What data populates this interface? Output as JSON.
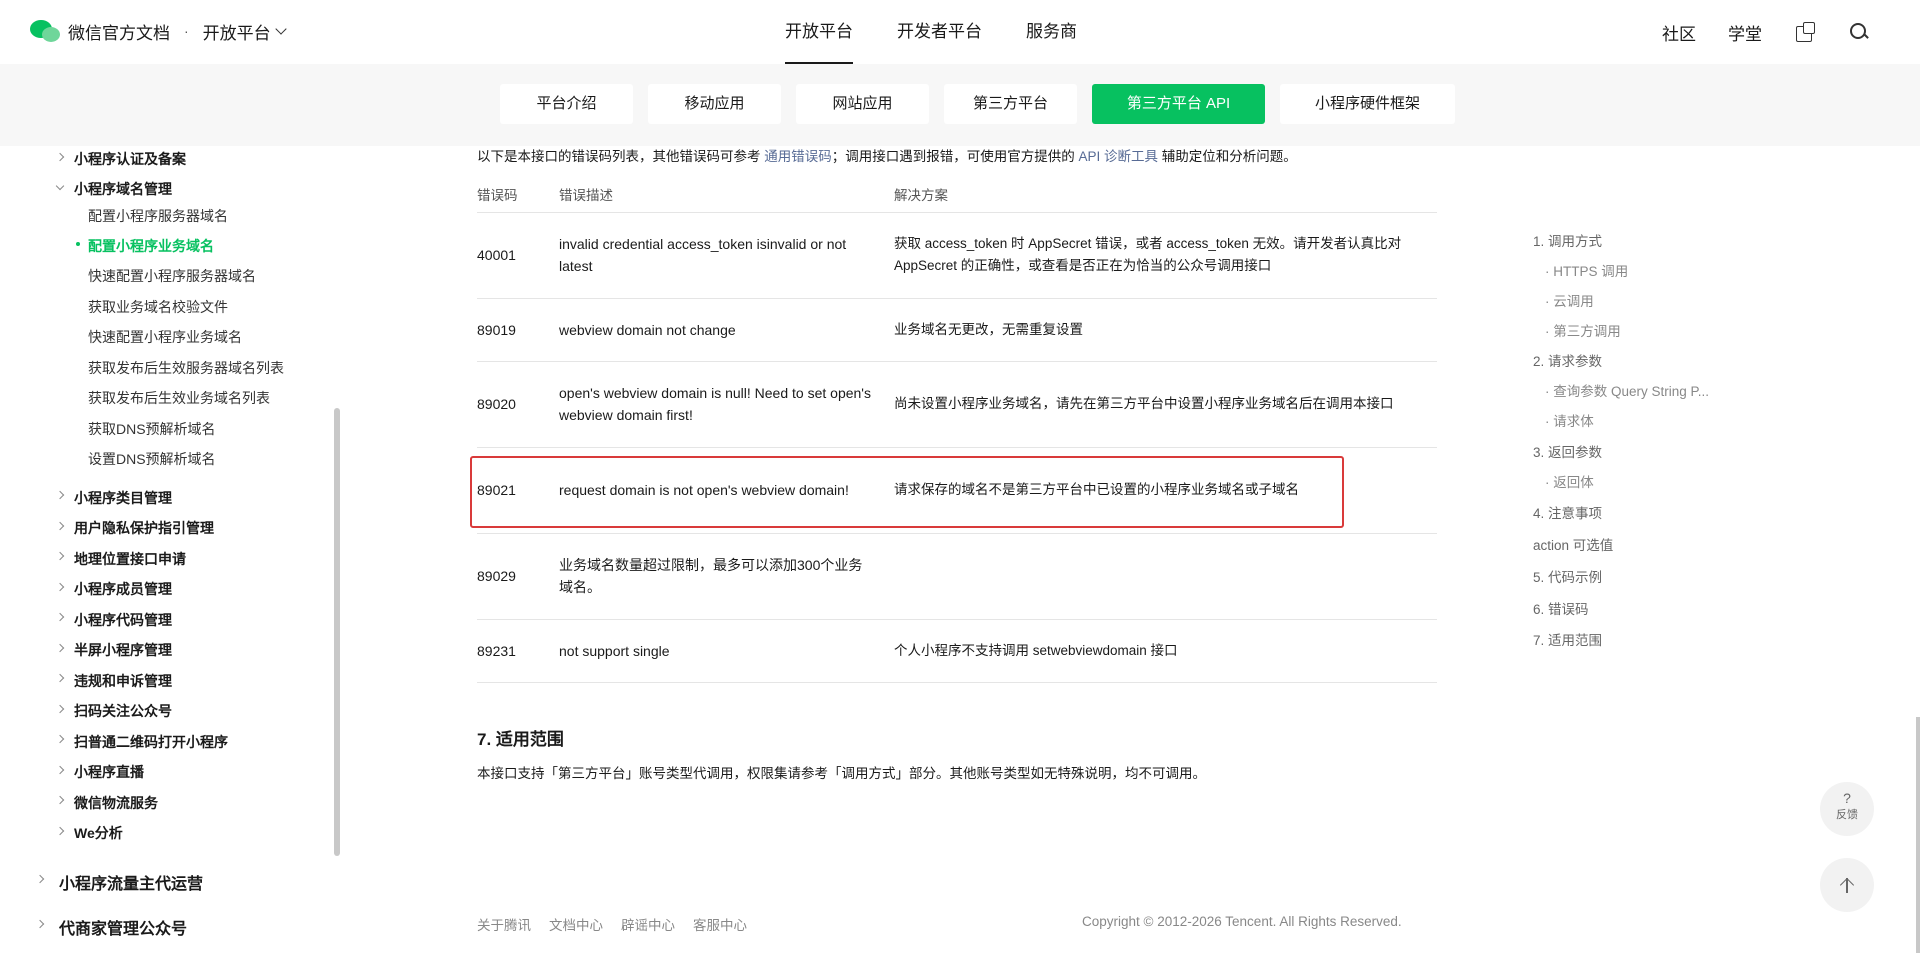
{
  "topnav": {
    "brand": "微信官方文档",
    "separator": "·",
    "section": "开放平台",
    "tabs": [
      {
        "label": "开放平台",
        "active": true
      },
      {
        "label": "开发者平台",
        "active": false
      },
      {
        "label": "服务商",
        "active": false
      }
    ],
    "links": [
      "社区",
      "学堂"
    ]
  },
  "subnav": {
    "tabs": [
      {
        "label": "平台介绍",
        "active": false
      },
      {
        "label": "移动应用",
        "active": false
      },
      {
        "label": "网站应用",
        "active": false
      },
      {
        "label": "第三方平台",
        "active": false
      },
      {
        "label": "第三方平台 API",
        "active": true
      },
      {
        "label": "小程序硬件框架",
        "active": false
      }
    ]
  },
  "sidebar": {
    "items": [
      "小程序认证及备案",
      "小程序域名管理",
      "配置小程序服务器域名",
      "配置小程序业务域名",
      "快速配置小程序服务器域名",
      "获取业务域名校验文件",
      "快速配置小程序业务域名",
      "获取发布后生效服务器域名列表",
      "获取发布后生效业务域名列表",
      "获取DNS预解析域名",
      "设置DNS预解析域名",
      "小程序类目管理",
      "用户隐私保护指引管理",
      "地理位置接口申请",
      "小程序成员管理",
      "小程序代码管理",
      "半屏小程序管理",
      "违规和申诉管理",
      "扫码关注公众号",
      "扫普通二维码打开小程序",
      "小程序直播",
      "微信物流服务",
      "We分析",
      "小程序流量主代运营",
      "代商家管理公众号"
    ]
  },
  "content": {
    "intro_prefix": "以下是本接口的错误码列表，其他错误码可参考 ",
    "intro_link1": "通用错误码",
    "intro_mid": "；调用接口遇到报错，可使用官方提供的 ",
    "intro_link2": "API 诊断工具",
    "intro_suffix": " 辅助定位和分析问题。",
    "table_headers": [
      "错误码",
      "错误描述",
      "解决方案"
    ],
    "rows": [
      {
        "code": "40001",
        "desc": "invalid credential  access_token isinvalid or not latest",
        "solution": "获取 access_token 时 AppSecret 错误，或者 access_token 无效。请开发者认真比对 AppSecret 的正确性，或查看是否正在为恰当的公众号调用接口"
      },
      {
        "code": "89019",
        "desc": "webview domain not change",
        "solution": "业务域名无更改，无需重复设置"
      },
      {
        "code": "89020",
        "desc": "open's webview domain is null! Need to set open's webview domain first!",
        "solution": "尚未设置小程序业务域名，请先在第三方平台中设置小程序业务域名后在调用本接口"
      },
      {
        "code": "89021",
        "desc": "request domain is not open's webview domain!",
        "solution": "请求保存的域名不是第三方平台中已设置的小程序业务域名或子域名"
      },
      {
        "code": "89029",
        "desc": "业务域名数量超过限制，最多可以添加300个业务域名。",
        "solution": ""
      },
      {
        "code": "89231",
        "desc": "not support single",
        "solution": "个人小程序不支持调用 setwebviewdomain 接口"
      }
    ],
    "section_title": "7. 适用范围",
    "section_body": "本接口支持「第三方平台」账号类型代调用，权限集请参考「调用方式」部分。其他账号类型如无特殊说明，均不可调用。"
  },
  "footer": {
    "links": [
      "关于腾讯",
      "文档中心",
      "辟谣中心",
      "客服中心"
    ],
    "copyright": "Copyright © 2012-2026 Tencent. All Rights Reserved."
  },
  "toc": {
    "items": [
      "1. 调用方式",
      "· HTTPS 调用",
      "· 云调用",
      "· 第三方调用",
      "2. 请求参数",
      "· 查询参数 Query String P...",
      "· 请求体",
      "3. 返回参数",
      "· 返回体",
      "4. 注意事项",
      "action 可选值",
      "5. 代码示例",
      "6. 错误码",
      "7. 适用范围"
    ]
  },
  "floating": {
    "feedback_q": "?",
    "feedback_label": "反馈"
  }
}
